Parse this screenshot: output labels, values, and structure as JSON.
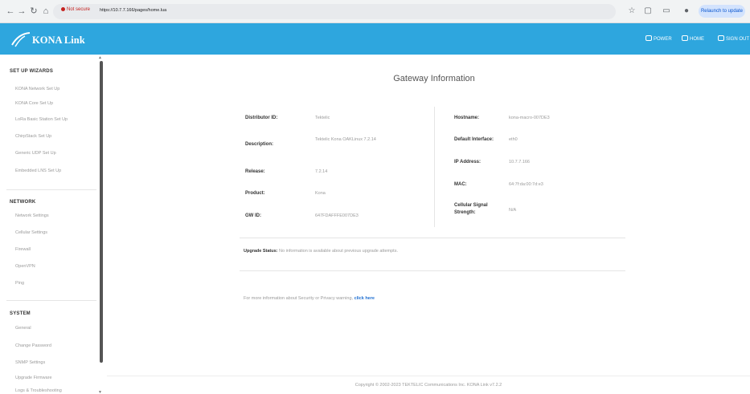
{
  "browser": {
    "not_secure": "Not secure",
    "url": "https://10.7.7.166/pages/home.lua",
    "relaunch_label": "Relaunch to update"
  },
  "header": {
    "brand": "KONA Link",
    "links": [
      {
        "label": "POWER",
        "icon": "power-icon"
      },
      {
        "label": "HOME",
        "icon": "home-icon"
      },
      {
        "label": "SIGN OUT",
        "icon": "sign-out-icon"
      }
    ],
    "background": "#2ea6de"
  },
  "sidebar": {
    "sections": [
      {
        "title": "SET UP WIZARDS",
        "items": [
          "KONA Network Set Up",
          "KONA Core Set Up",
          "LoRa Basic Station Set Up",
          "ChirpStack Set Up",
          "Generic UDP Set Up",
          "Embedded LNS Set Up"
        ]
      },
      {
        "title": "NETWORK",
        "items": [
          "Network Settings",
          "Cellular Settings",
          "Firewall",
          "OpenVPN",
          "Ping"
        ]
      },
      {
        "title": "SYSTEM",
        "items": [
          "General",
          "Change Password",
          "SNMP Settings",
          "Upgrade Firmware",
          "Logs & Troubleshooting"
        ]
      }
    ]
  },
  "main": {
    "title": "Gateway Information",
    "left_fields": [
      {
        "label": "Distributor ID:",
        "value": "Tektelic"
      },
      {
        "label": "Description:",
        "value": "Tektelic Kona OAKLinux 7.2.14"
      },
      {
        "label": "Release:",
        "value": "7.2.14"
      },
      {
        "label": "Product:",
        "value": "Kona"
      },
      {
        "label": "GW ID:",
        "value": "647FDAFFFE007DE3"
      }
    ],
    "right_fields": [
      {
        "label": "Hostname:",
        "value": "kona-macro-007DE3"
      },
      {
        "label": "Default Interface:",
        "value": "eth0"
      },
      {
        "label": "IP Address:",
        "value": "10.7.7.166"
      },
      {
        "label": "MAC:",
        "value": "64:7f:da:00:7d:e3"
      },
      {
        "label": "Cellular Signal Strength:",
        "value": "N/A"
      }
    ],
    "upgrade_label": "Upgrade Status:",
    "upgrade_text": "No information is available about previous upgrade attempts.",
    "more_info_text": "For more information about Security or Privacy warning,",
    "more_info_link": "click here",
    "footer": "Copyright © 2002-2023 TEKTELIC Communications Inc. KONA Link v7.2.2"
  }
}
